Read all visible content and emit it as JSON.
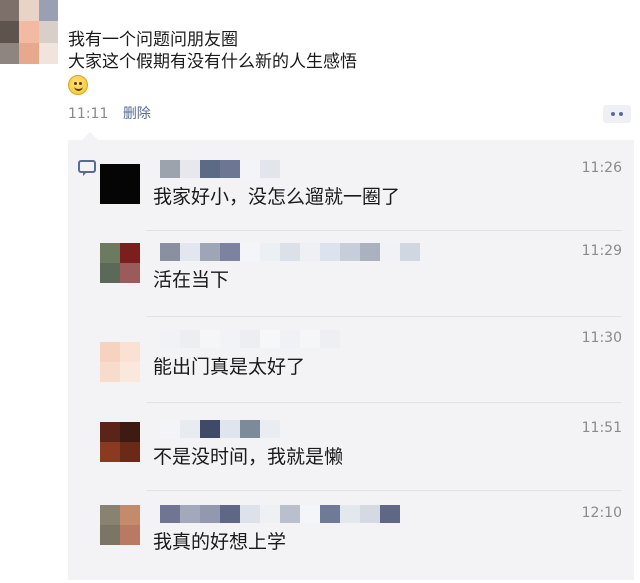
{
  "post": {
    "text_line1": "我有一个问题问朋友圈",
    "text_line2": "大家这个假期有没有什么新的人生感悟",
    "emoji": "smile-emoji",
    "time": "11:11",
    "delete_label": "删除"
  },
  "comments": [
    {
      "text": "我家好小，没怎么遛就一圈了",
      "time": "11:26"
    },
    {
      "text": "活在当下",
      "time": "11:29"
    },
    {
      "text": "能出门真是太好了",
      "time": "11:30"
    },
    {
      "text": "不是没时间，我就是懒",
      "time": "11:51"
    },
    {
      "text": "我真的好想上学",
      "time": "12:10"
    }
  ],
  "colors": {
    "link": "#576b95",
    "meta": "#8a8a8a",
    "panel": "#f3f3f5"
  }
}
